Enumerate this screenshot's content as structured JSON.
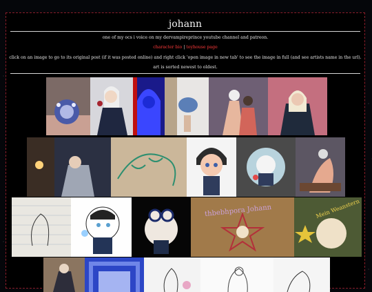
{
  "header": {
    "title": "johann"
  },
  "intro": {
    "line1": "one of my ocs i voice on my dervampireprince youtube channel and patreon.",
    "link1": "character bio",
    "separator": "|",
    "link2": "toyhouse page",
    "line3": "click on an image to go to its original post (if it was posted online) and right click 'open image in new tab' to see the image in full (and see artists name in the url).",
    "line4": "art is sorted newest to oldest."
  },
  "gallery": {
    "stamp_text_1": "thbebhpora Johann",
    "stamp_text_2": "Mein Weanstern"
  },
  "colors": {
    "border_accent": "#8c1d2a",
    "link": "#ff3b3b",
    "background": "#000000"
  }
}
